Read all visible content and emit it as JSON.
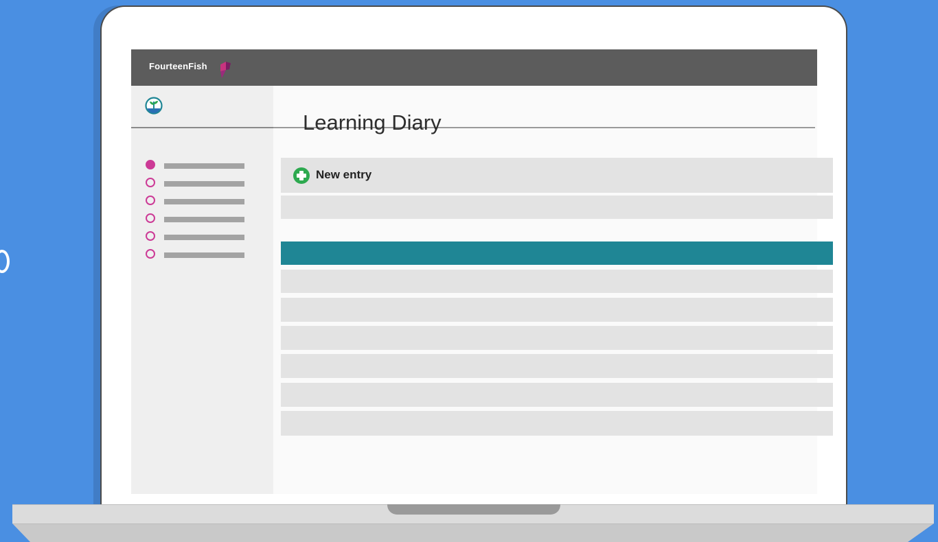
{
  "app": {
    "brand": "FourteenFish",
    "title": "Learning Diary"
  },
  "sidebar": {
    "items": [
      {
        "state": "active"
      },
      {
        "state": "inactive"
      },
      {
        "state": "inactive"
      },
      {
        "state": "inactive"
      },
      {
        "state": "inactive"
      },
      {
        "state": "inactive"
      }
    ]
  },
  "main": {
    "new_entry_label": "New entry",
    "entries_count_visible_rows": 7,
    "active_row_index": 0
  },
  "colors": {
    "background": "#4a8fe2",
    "topbar": "#5c5c5c",
    "accent_pink": "#cc3a96",
    "active_row": "#1f8695",
    "add_icon_green": "#2da94f"
  },
  "icons": {
    "logo": "plant-logo-icon",
    "brand_mark": "fish-mark-icon",
    "new_entry": "plus-circle-icon"
  }
}
